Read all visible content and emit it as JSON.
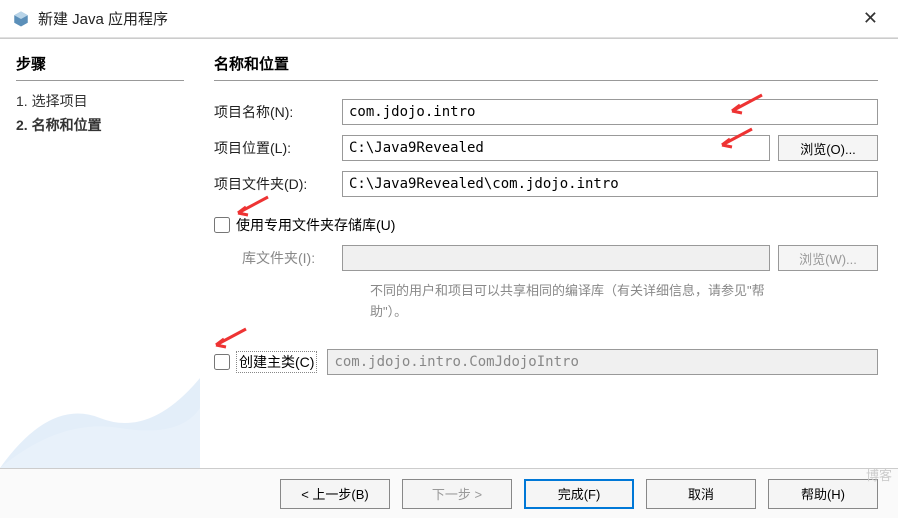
{
  "titlebar": {
    "title": "新建 Java 应用程序"
  },
  "sidebar": {
    "heading": "步骤",
    "items": [
      "选择项目",
      "名称和位置"
    ],
    "current": 1
  },
  "main": {
    "heading": "名称和位置",
    "rows": {
      "name_label": "项目名称(N):",
      "name_value": "com.jdojo.intro",
      "loc_label": "项目位置(L):",
      "loc_value": "C:\\Java9Revealed",
      "browse1": "浏览(O)...",
      "folder_label": "项目文件夹(D):",
      "folder_value": "C:\\Java9Revealed\\com.jdojo.intro",
      "chk1_label": "使用专用文件夹存储库(U)",
      "lib_label": "库文件夹(I):",
      "lib_value": "",
      "browse2": "浏览(W)...",
      "hint": "不同的用户和项目可以共享相同的编译库（有关详细信息，请参见\"帮助\"）。",
      "chk2_label": "创建主类(C)",
      "main_value": "com.jdojo.intro.ComJdojoIntro"
    }
  },
  "footer": {
    "back": "< 上一步(B)",
    "next": "下一步 >",
    "finish": "完成(F)",
    "cancel": "取消",
    "help": "帮助(H)"
  },
  "watermark": "博客"
}
